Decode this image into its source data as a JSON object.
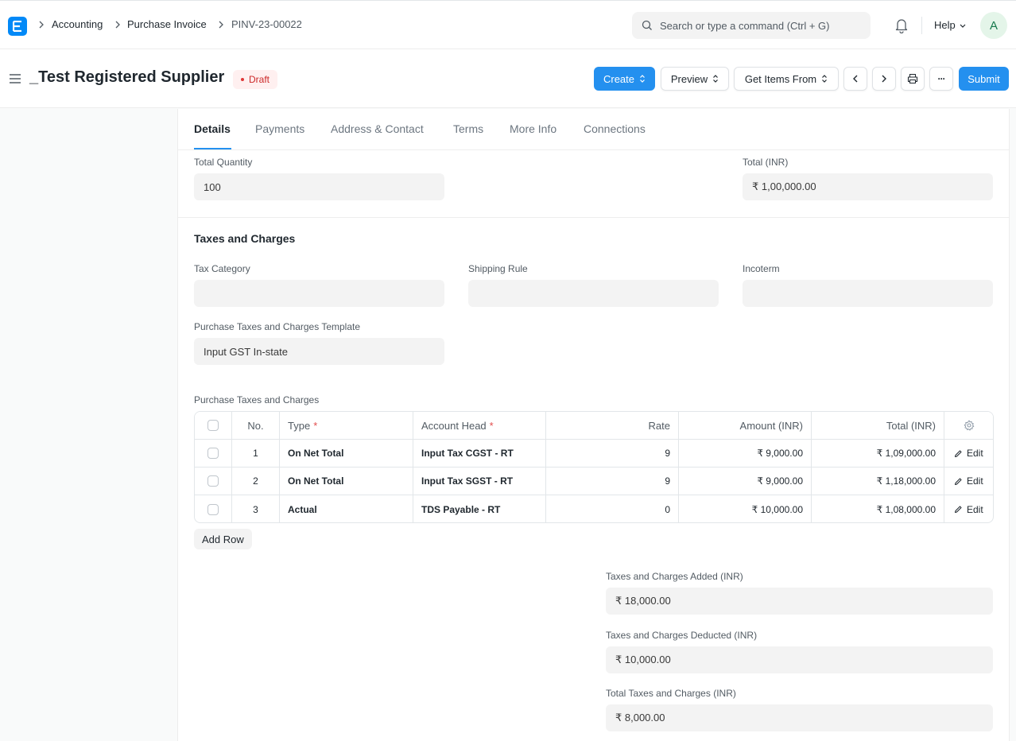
{
  "breadcrumbs": [
    "Accounting",
    "Purchase Invoice",
    "PINV-23-00022"
  ],
  "search": {
    "placeholder": "Search or type a command (Ctrl + G)"
  },
  "help_label": "Help",
  "avatar_initial": "A",
  "page": {
    "title": "_Test Registered Supplier",
    "status": "Draft"
  },
  "actions": {
    "create": "Create",
    "preview": "Preview",
    "get_items_from": "Get Items From",
    "submit": "Submit",
    "more": "···"
  },
  "tabs": [
    "Details",
    "Payments",
    "Address & Contact",
    "Terms",
    "More Info",
    "Connections"
  ],
  "totals": {
    "total_quantity_label": "Total Quantity",
    "total_quantity": "100",
    "total_label": "Total (INR)",
    "total": "₹ 1,00,000.00"
  },
  "taxes_section": {
    "title": "Taxes and Charges",
    "tax_category_label": "Tax Category",
    "tax_category": "",
    "shipping_rule_label": "Shipping Rule",
    "shipping_rule": "",
    "incoterm_label": "Incoterm",
    "incoterm": "",
    "template_label": "Purchase Taxes and Charges Template",
    "template": "Input GST In-state",
    "table_label": "Purchase Taxes and Charges"
  },
  "table": {
    "headers": {
      "no": "No.",
      "type": "Type",
      "account_head": "Account Head",
      "rate": "Rate",
      "amount": "Amount (INR)",
      "total": "Total (INR)"
    },
    "rows": [
      {
        "no": "1",
        "type": "On Net Total",
        "account_head": "Input Tax CGST - RT",
        "rate": "9",
        "amount": "₹ 9,000.00",
        "total": "₹ 1,09,000.00",
        "edit": "Edit"
      },
      {
        "no": "2",
        "type": "On Net Total",
        "account_head": "Input Tax SGST - RT",
        "rate": "9",
        "amount": "₹ 9,000.00",
        "total": "₹ 1,18,000.00",
        "edit": "Edit"
      },
      {
        "no": "3",
        "type": "Actual",
        "account_head": "TDS Payable - RT",
        "rate": "0",
        "amount": "₹ 10,000.00",
        "total": "₹ 1,08,000.00",
        "edit": "Edit"
      }
    ],
    "add_row": "Add Row"
  },
  "summary": {
    "added_label": "Taxes and Charges Added (INR)",
    "added": "₹ 18,000.00",
    "deducted_label": "Taxes and Charges Deducted (INR)",
    "deducted": "₹ 10,000.00",
    "total_label": "Total Taxes and Charges (INR)",
    "total": "₹ 8,000.00"
  }
}
